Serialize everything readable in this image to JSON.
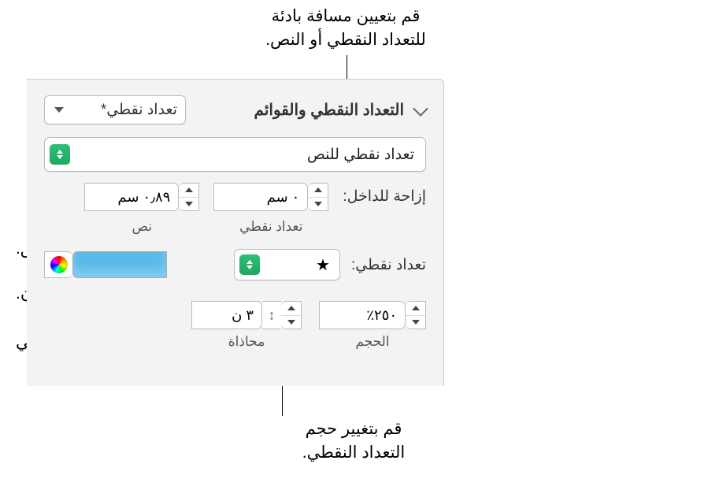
{
  "callouts": {
    "top": "قم بتعيين مسافة بادئة\nللتعداد النقطي أو النص.",
    "color_coord": "قم باختيار لون منسق.",
    "open_colors": "قم بفتح نافذة الألوان.",
    "move_bullet": "قم بتحريك التعداد النقطي\nلأعلى أو لأسفل.",
    "resize_bullet": "قم بتغيير حجم\nالتعداد النقطي."
  },
  "panel": {
    "section_title": "التعداد النقطي والقوائم",
    "style_label": "تعداد نقطي*",
    "list_type": "تعداد نقطي للنص",
    "indent_label": "إزاحة للداخل:",
    "indent_bullet": {
      "value": "٠ سم",
      "caption": "تعداد نقطي"
    },
    "indent_text": {
      "value": "٠٫٨٩ سم",
      "caption": "نص"
    },
    "bullet_label": "تعداد نقطي:",
    "bullet_glyph": "★",
    "color_hex": "#59baea",
    "size": {
      "value": "٢٥٠٪",
      "caption": "الحجم"
    },
    "align": {
      "value": "٣ ن",
      "caption": "محاذاة"
    }
  }
}
